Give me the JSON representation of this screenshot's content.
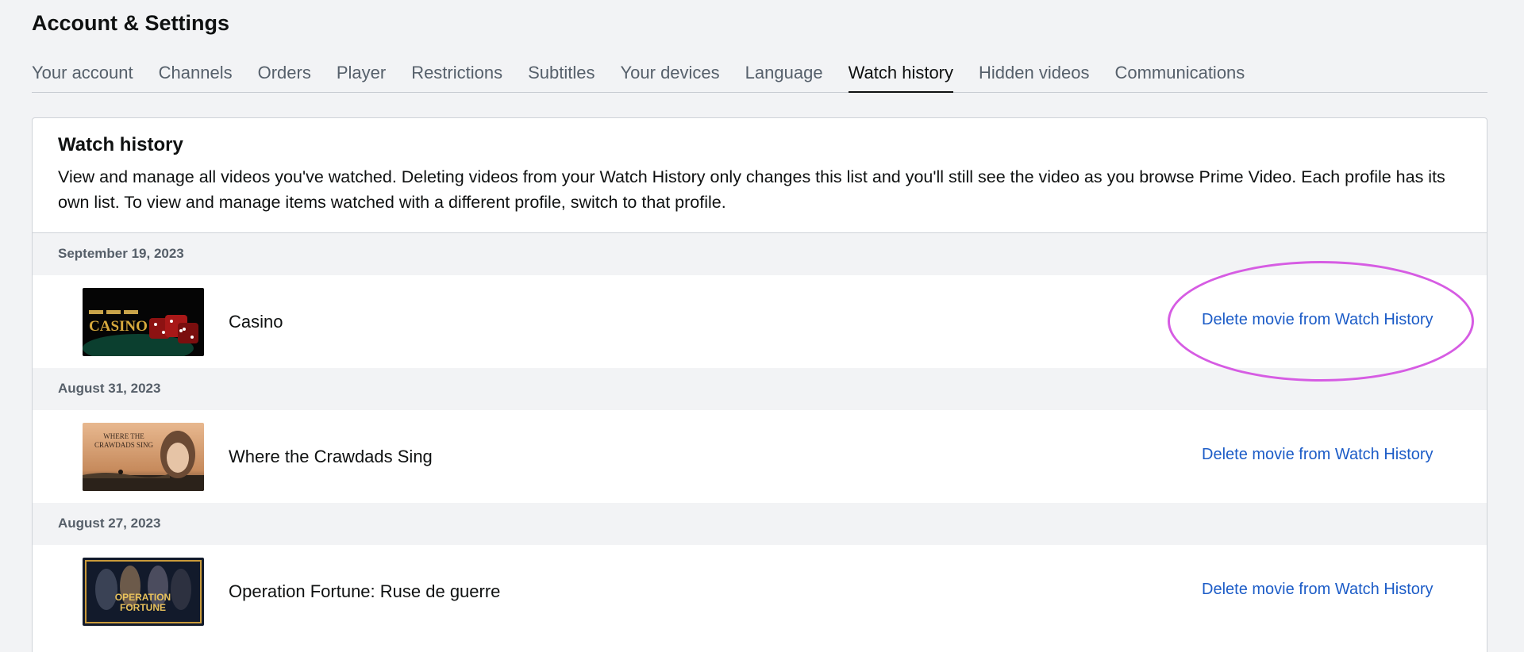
{
  "page": {
    "title": "Account & Settings"
  },
  "tabs": [
    {
      "label": "Your account"
    },
    {
      "label": "Channels"
    },
    {
      "label": "Orders"
    },
    {
      "label": "Player"
    },
    {
      "label": "Restrictions"
    },
    {
      "label": "Subtitles"
    },
    {
      "label": "Your devices"
    },
    {
      "label": "Language"
    },
    {
      "label": "Watch history",
      "active": true
    },
    {
      "label": "Hidden videos"
    },
    {
      "label": "Communications"
    }
  ],
  "panel": {
    "title": "Watch history",
    "description": "View and manage all videos you've watched. Deleting videos from your Watch History only changes this list and you'll still see the video as you browse Prime Video. Each profile has its own list. To view and manage items watched with a different profile, switch to that profile."
  },
  "history": [
    {
      "date": "September 19, 2023",
      "title": "Casino",
      "action": "Delete movie from Watch History"
    },
    {
      "date": "August 31, 2023",
      "title": "Where the Crawdads Sing",
      "action": "Delete movie from Watch History"
    },
    {
      "date": "August 27, 2023",
      "title": "Operation Fortune: Ruse de guerre",
      "action": "Delete movie from Watch History"
    }
  ],
  "thumbnail_text": {
    "casino": "CASINO",
    "crawdads": [
      "WHERE THE",
      "CRAWDADS SING"
    ],
    "fortune": [
      "OPERATION",
      "FORTUNE"
    ]
  },
  "colors": {
    "link": "#1c5cc7",
    "annotation": "#d65ce3",
    "background": "#f2f3f5"
  }
}
